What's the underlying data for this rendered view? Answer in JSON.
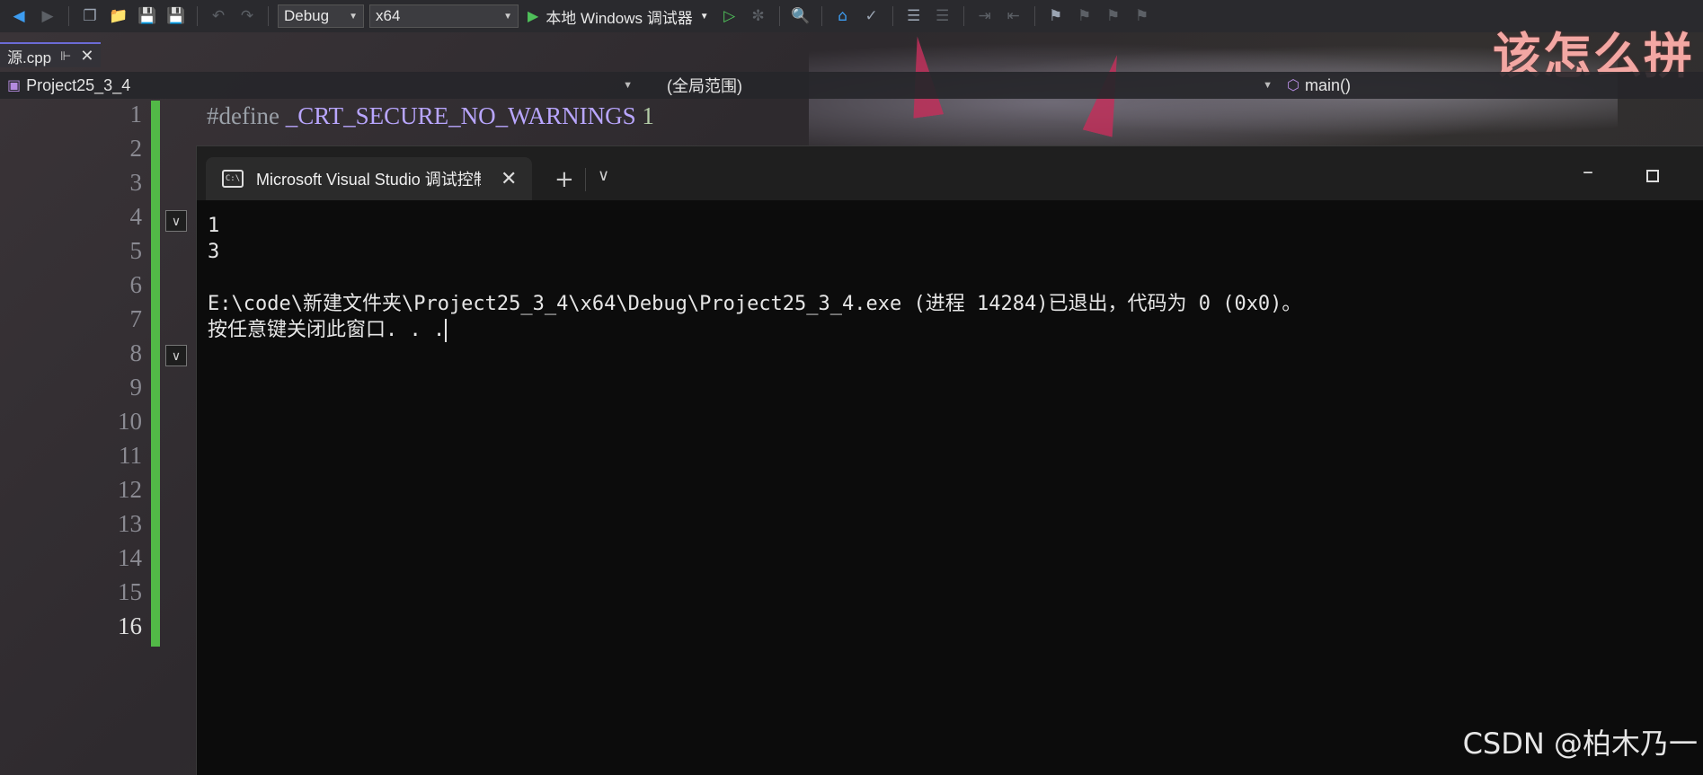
{
  "toolbar": {
    "config": "Debug",
    "platform": "x64",
    "run_label": "本地 Windows 调试器"
  },
  "editor": {
    "file_tab": "源.cpp",
    "watermark": "该怎么拼",
    "nav_project": "Project25_3_4",
    "nav_scope": "(全局范围)",
    "nav_member": "main()",
    "line_numbers": [
      "1",
      "2",
      "3",
      "4",
      "5",
      "6",
      "7",
      "8",
      "9",
      "10",
      "11",
      "12",
      "13",
      "14",
      "15",
      "16"
    ],
    "code_prefix": "#define ",
    "code_macro": "_CRT_SECURE_NO_WARNINGS",
    "code_value": "1",
    "colors": {
      "change_bar": "#52b947",
      "accent": "#3d9cf0"
    }
  },
  "console": {
    "tab_title": "Microsoft Visual Studio 调试控制台",
    "output": [
      "1",
      "3",
      "",
      "E:\\code\\新建文件夹\\Project25_3_4\\x64\\Debug\\Project25_3_4.exe (进程 14284)已退出，代码为 0 (0x0)。",
      "按任意键关闭此窗口. . ."
    ]
  },
  "footer_watermark": "CSDN @柏木乃一"
}
